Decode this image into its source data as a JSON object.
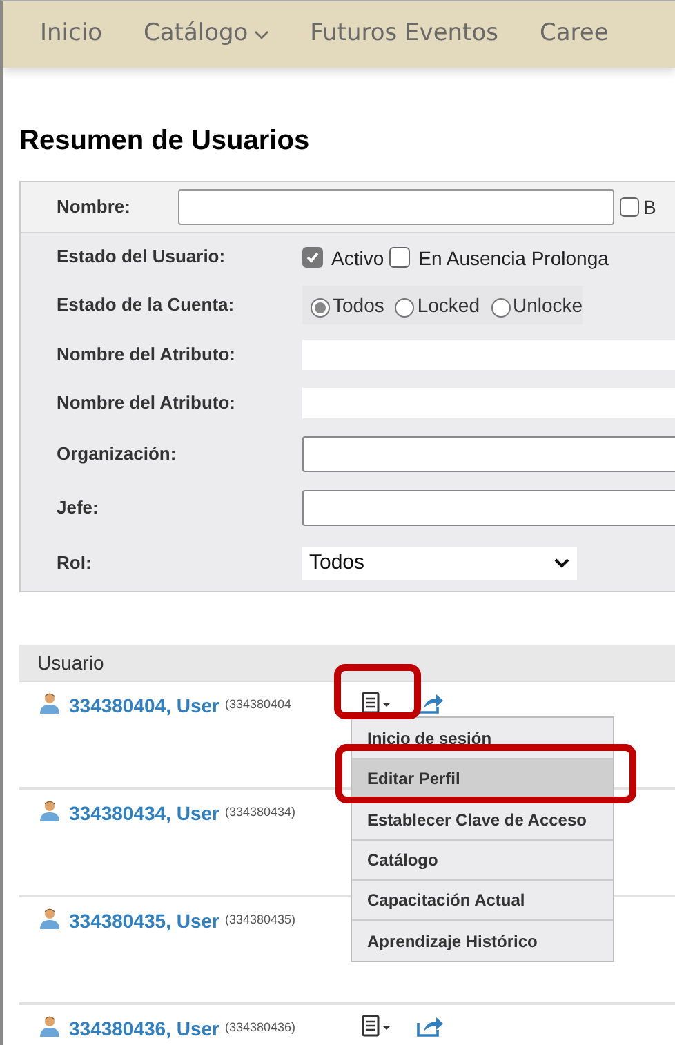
{
  "nav": [
    {
      "label": "Inicio",
      "dropdown": false
    },
    {
      "label": "Catálogo",
      "dropdown": true
    },
    {
      "label": "Futuros Eventos",
      "dropdown": false
    },
    {
      "label": "Caree",
      "dropdown": false
    }
  ],
  "title": "Resumen de Usuarios",
  "filters": {
    "name_label": "Nombre:",
    "name_checkbox": {
      "label": "B",
      "checked": false
    },
    "user_state_label": "Estado del Usuario:",
    "user_states": [
      {
        "label": "Activo",
        "checked": true
      },
      {
        "label": "En Ausencia Prolonga",
        "checked": false
      }
    ],
    "account_state_label": "Estado de la Cuenta:",
    "account_states": [
      {
        "label": "Todos",
        "selected": true
      },
      {
        "label": "Locked",
        "selected": false
      },
      {
        "label": "Unlocke",
        "selected": false
      }
    ],
    "attribute_labels": [
      "Nombre del Atributo:",
      "Nombre del Atributo:"
    ],
    "organization_label": "Organización:",
    "manager_label": "Jefe:",
    "role_label": "Rol:",
    "role_value": "Todos"
  },
  "table": {
    "column": "Usuario",
    "rows": [
      {
        "name": "334380404, User",
        "id": "(334380404",
        "show_actions": true
      },
      {
        "name": "334380434, User",
        "id": "(334380434)",
        "show_actions": false
      },
      {
        "name": "334380435, User",
        "id": "(334380435)",
        "show_actions": false
      },
      {
        "name": "334380436, User",
        "id": "(334380436)",
        "show_actions": true
      }
    ]
  },
  "menu": {
    "items": [
      {
        "label": "Inicio de sesión",
        "selected": false
      },
      {
        "label": "Editar Perfil",
        "selected": true
      },
      {
        "label": "Establecer Clave de Acceso",
        "selected": false
      },
      {
        "label": "Catálogo",
        "selected": false
      },
      {
        "label": "Capacitación Actual",
        "selected": false
      },
      {
        "label": "Aprendizaje Histórico",
        "selected": false
      }
    ]
  }
}
